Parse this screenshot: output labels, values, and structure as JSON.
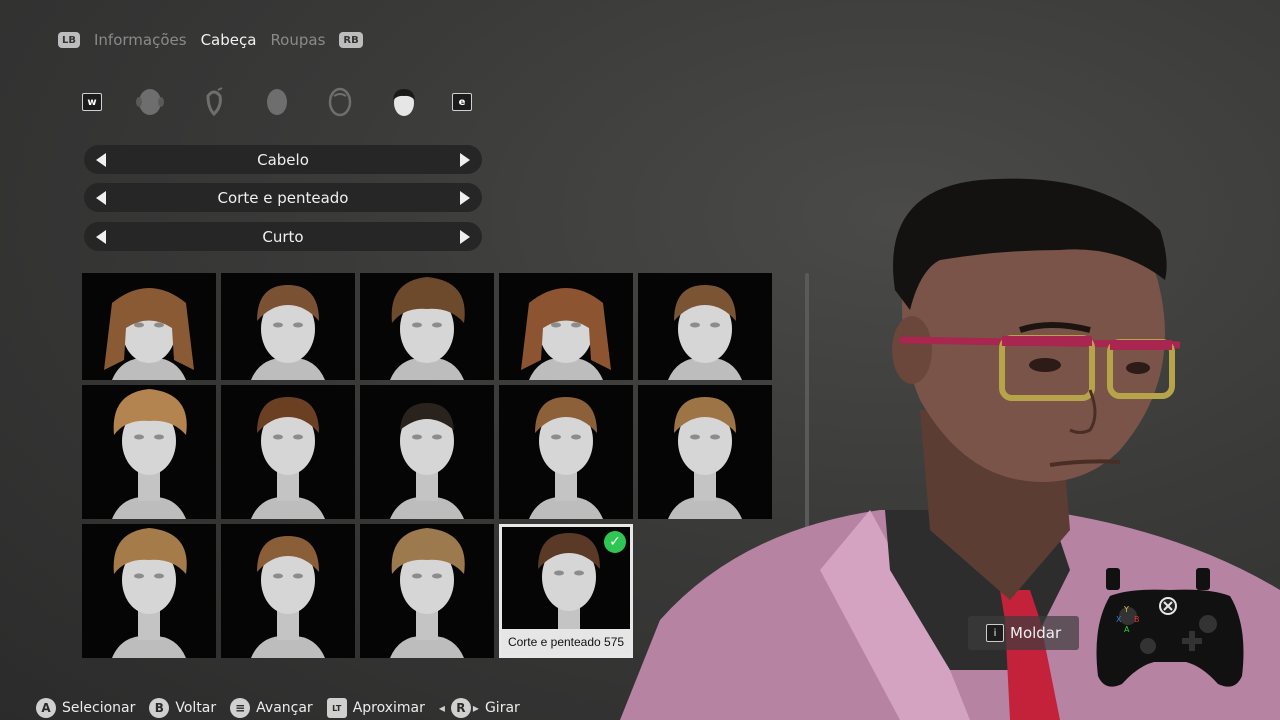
{
  "tabs": {
    "left_bumper": "LB",
    "right_bumper": "RB",
    "items": [
      {
        "label": "Informações",
        "active": false
      },
      {
        "label": "Cabeça",
        "active": true
      },
      {
        "label": "Roupas",
        "active": false
      }
    ]
  },
  "categories": {
    "prev_key": "w",
    "next_key": "e",
    "icons": [
      "head-shape-icon",
      "ear-icon",
      "face-icon",
      "face-outline-icon",
      "hair-icon"
    ],
    "active_index": 4
  },
  "selectors": [
    {
      "label": "Cabelo"
    },
    {
      "label": "Corte e penteado"
    },
    {
      "label": "Curto"
    }
  ],
  "hair_grid": {
    "selected_index": 13,
    "selected_caption": "Corte e penteado 575",
    "tiles": [
      {
        "hair_color": "#8a5a34",
        "style": "long-swept"
      },
      {
        "hair_color": "#7a5233",
        "style": "quiff"
      },
      {
        "hair_color": "#6e4a2c",
        "style": "curly-top"
      },
      {
        "hair_color": "#8c5430",
        "style": "long-wavy"
      },
      {
        "hair_color": "#7a5433",
        "style": "short"
      },
      {
        "hair_color": "#b3844f",
        "style": "curly-volume"
      },
      {
        "hair_color": "#6b3f22",
        "style": "side-swept"
      },
      {
        "hair_color": "#2a221d",
        "style": "buzz"
      },
      {
        "hair_color": "#8c6038",
        "style": "curly-short"
      },
      {
        "hair_color": "#9c7446",
        "style": "curly-short"
      },
      {
        "hair_color": "#a57b4a",
        "style": "spiky"
      },
      {
        "hair_color": "#8a5e39",
        "style": "pompadour"
      },
      {
        "hair_color": "#9c7a4e",
        "style": "messy"
      },
      {
        "hair_color": "#5a3a26",
        "style": "short-crop"
      }
    ]
  },
  "preview_action": {
    "key": "i",
    "label": "Moldar"
  },
  "hints": [
    {
      "button": "A",
      "label": "Selecionar"
    },
    {
      "button": "B",
      "label": "Voltar"
    },
    {
      "button": "≡",
      "label": "Avançar"
    },
    {
      "button": "LT",
      "label": "Aproximar"
    },
    {
      "button": "R",
      "label": "Girar"
    }
  ],
  "colors": {
    "check": "#2fc653",
    "jacket": "#b683a3",
    "tie": "#c4213a",
    "glasses": "#a8264f"
  }
}
